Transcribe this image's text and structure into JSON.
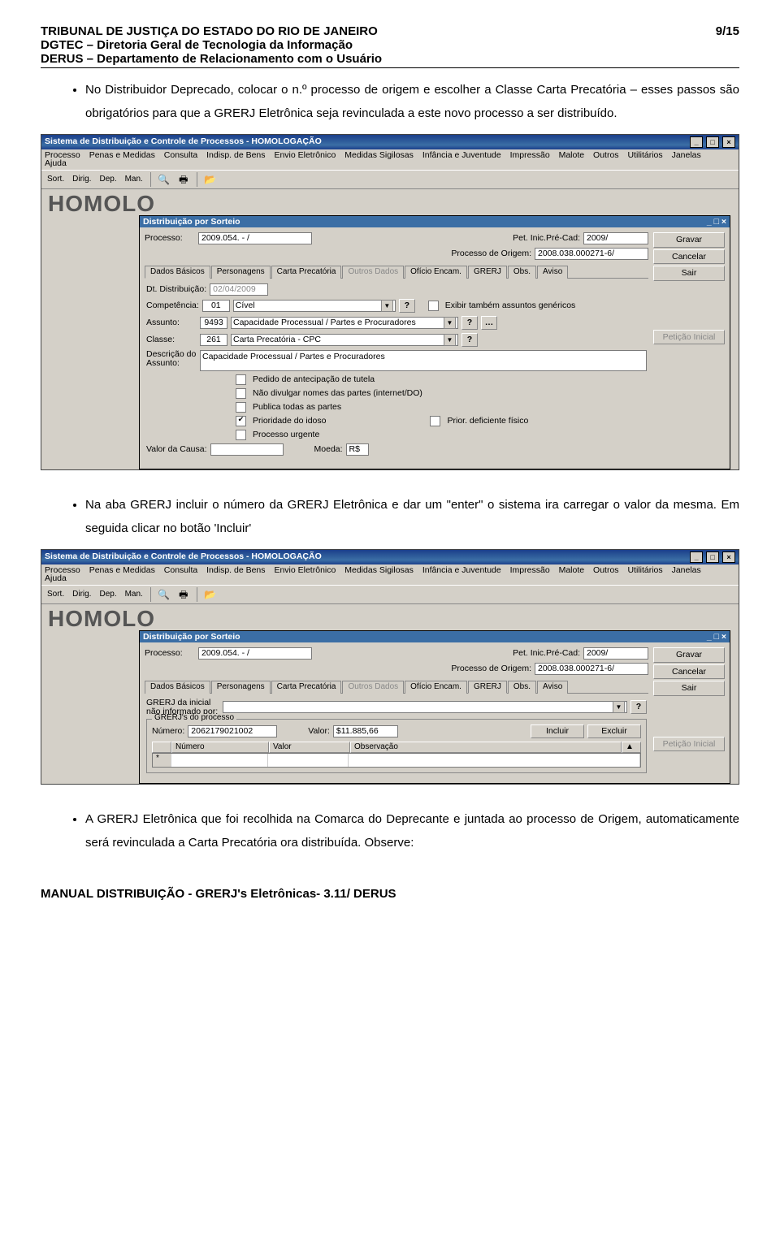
{
  "page_number": "9/15",
  "header": {
    "line1": "TRIBUNAL DE JUSTIÇA DO ESTADO DO RIO DE JANEIRO",
    "line2": "DGTEC – Diretoria Geral de Tecnologia da Informação",
    "line3": "DERUS – Departamento de Relacionamento com o Usuário"
  },
  "bullets": {
    "b1": "No Distribuidor Deprecado, colocar o n.º processo de origem e escolher a Classe Carta Precatória – esses passos são obrigatórios para que a GRERJ Eletrônica seja revinculada a este novo processo a ser distribuído.",
    "b2": "Na aba GRERJ incluir o número da GRERJ Eletrônica e dar um \"enter\" o sistema ira carregar o valor da mesma. Em seguida clicar no botão 'Incluir'",
    "b3": "A GRERJ Eletrônica que foi recolhida na Comarca do Deprecante e juntada ao processo de Origem, automaticamente será revinculada a Carta Precatória ora distribuída. Observe:"
  },
  "app": {
    "title": "Sistema de Distribuição e Controle de Processos - HOMOLOGAÇÃO",
    "subwin_title": "Distribuição por Sorteio",
    "bigword": "HOMOLO",
    "menu": [
      "Processo",
      "Penas e Medidas",
      "Consulta",
      "Indisp. de Bens",
      "Envio Eletrônico",
      "Medidas Sigilosas",
      "Infância e Juventude",
      "Impressão",
      "Malote",
      "Outros",
      "Utilitários",
      "Janelas",
      "Ajuda"
    ],
    "toolbar_text": [
      "Sort.",
      "Dirig.",
      "Dep.",
      "Man."
    ],
    "buttons": {
      "gravar": "Gravar",
      "cancelar": "Cancelar",
      "sair": "Sair",
      "peticao": "Petição Inicial",
      "incluir": "Incluir",
      "excluir": "Excluir"
    },
    "labels": {
      "processo": "Processo:",
      "peticao": "Pet. Inic.Pré-Cad:",
      "proc_origem": "Processo de Origem:",
      "dt_dist": "Dt. Distribuição:",
      "competencia": "Competência:",
      "assunto": "Assunto:",
      "classe": "Classe:",
      "desc_assunto": "Descrição do\nAssunto:",
      "valor_causa": "Valor da Causa:",
      "moeda": "Moeda:",
      "grerj_nao_inf": "GRERJ da inicial\nnão informado por:",
      "numero": "Número:",
      "valor": "Valor:"
    },
    "tabs": [
      "Dados Básicos",
      "Personagens",
      "Carta Precatória",
      "Outros Dados",
      "Ofício Encam.",
      "GRERJ",
      "Obs.",
      "Aviso"
    ],
    "values": {
      "processo": "2009.054.        - /",
      "peticao": "2009/",
      "proc_origem": "2008.038.000271-6/",
      "dt_dist": "02/04/2009",
      "competencia_cod": "01",
      "competencia_txt": "Cível",
      "assunto_cod": "9493",
      "assunto_txt": "Capacidade Processual / Partes e Procuradores",
      "classe_cod": "261",
      "classe_txt": "Carta Precatória - CPC",
      "desc_assunto": "Capacidade Processual /  Partes e Procuradores",
      "moeda": "R$",
      "grerj_num": "2062179021002",
      "grerj_valor": "$11.885,66"
    },
    "checkboxes": {
      "exibir_genericos": "Exibir também assuntos genéricos",
      "pedido_tutela": "Pedido de antecipação de tutela",
      "nao_divulgar": "Não divulgar nomes das partes (internet/DO)",
      "publica_todas": "Publica todas as partes",
      "prioridade_idoso": "Prioridade do idoso",
      "processo_urgente": "Processo urgente",
      "prior_def": "Prior. deficiente físico"
    },
    "grid_headers": [
      "Número",
      "Valor",
      "Observação"
    ]
  },
  "footer": "MANUAL DISTRIBUIÇÃO - GRERJ's Eletrônicas- 3.11/ DERUS"
}
